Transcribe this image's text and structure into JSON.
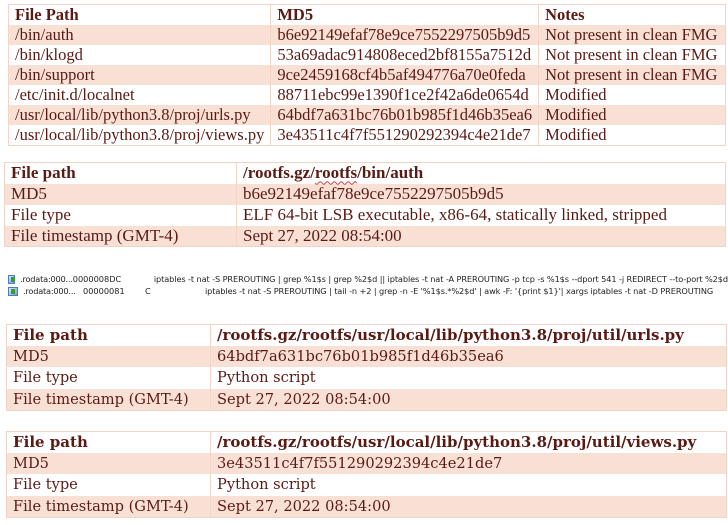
{
  "hash_table": {
    "headers": [
      "File Path",
      "MD5",
      "Notes"
    ],
    "rows": [
      {
        "path": "/bin/auth",
        "md5": "b6e92149efaf78e9ce7552297505b9d5",
        "notes": "Not present in clean FMG"
      },
      {
        "path": "/bin/klogd",
        "md5": "53a69adac914808eced2bf8155a7512d",
        "notes": "Not present in clean FMG"
      },
      {
        "path": "/bin/support",
        "md5": "9ce2459168cf4b5af494776a70e0feda",
        "notes": "Not present in clean FMG"
      },
      {
        "path": "/etc/init.d/localnet",
        "md5": "88711ebc99e1390f1ce2f42a6de0654d",
        "notes": "Modified"
      },
      {
        "path": "/usr/local/lib/python3.8/proj/urls.py",
        "md5": "64bdf7a631bc76b01b985f1d46b35ea6",
        "notes": "Modified"
      },
      {
        "path": "/usr/local/lib/python3.8/proj/views.py",
        "md5": "3e43511c4f7f551290292394c4e21de7",
        "notes": "Modified"
      }
    ]
  },
  "auth_table": {
    "path_label": "File path",
    "path_prefix": "/rootfs.gz/",
    "path_squiggle": "rootfs",
    "path_suffix": "/bin/auth",
    "md5_label": "MD5",
    "md5": "b6e92149efaf78e9ce7552297505b9d5",
    "type_label": "File type",
    "type": "ELF 64-bit LSB executable, x86-64, statically linked, stripped",
    "ts_label": "File timestamp (GMT-4)",
    "ts": "Sept 27, 2022 08:54:00"
  },
  "strings_view": {
    "rows": [
      {
        "icon": "string-icon",
        "address": ".rodata:000...",
        "length": "0000008D",
        "type": "C",
        "string": "iptables -t nat -S PREROUTING | grep %1$s | grep %2$d || iptables -t nat -A PREROUTING -p tcp -s %1$s --dport 541 -j REDIRECT --to-port %2$d"
      },
      {
        "icon": "string-icon",
        "address": ".rodata:000...",
        "length": "00000081",
        "type": "C",
        "string": "iptables -t nat -S PREROUTING | tail -n +2 | grep -n -E '%1$s.*%2$d' | awk -F: '{print $1}'| xargs iptables -t nat -D PREROUTING"
      }
    ]
  },
  "urls_table": {
    "path_label": "File path",
    "path": "/rootfs.gz/rootfs/usr/local/lib/python3.8/proj/util/urls.py",
    "md5_label": "MD5",
    "md5": "64bdf7a631bc76b01b985f1d46b35ea6",
    "type_label": "File type",
    "type": "Python script",
    "ts_label": "File timestamp (GMT-4)",
    "ts": "Sept 27, 2022 08:54:00"
  },
  "views_table": {
    "path_label": "File path",
    "path": "/rootfs.gz/rootfs/usr/local/lib/python3.8/proj/util/views.py",
    "md5_label": "MD5",
    "md5": "3e43511c4f7f551290292394c4e21de7",
    "type_label": "File type",
    "type": "Python script",
    "ts_label": "File timestamp (GMT-4)",
    "ts": "Sept 27, 2022 08:54:00"
  }
}
